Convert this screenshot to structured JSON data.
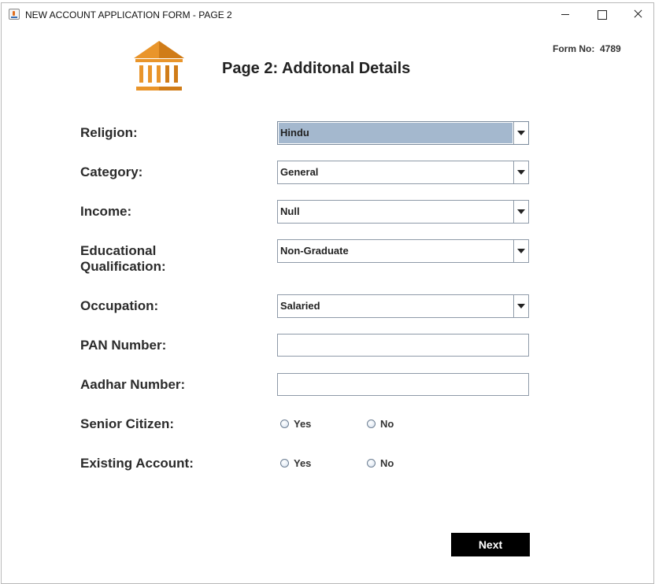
{
  "window": {
    "title": "NEW ACCOUNT APPLICATION FORM - PAGE 2"
  },
  "header": {
    "form_no_label": "Form No:",
    "form_no_value": "4789",
    "heading": "Page 2: Additonal Details",
    "logo_icon": "bank-building-icon"
  },
  "colors": {
    "logo": "#e9952b",
    "selection_highlight": "#a4b8ce",
    "next_button_bg": "#000000",
    "next_button_text": "#ffffff"
  },
  "fields": {
    "religion": {
      "label": "Religion:",
      "value": "Hindu"
    },
    "category": {
      "label": "Category:",
      "value": "General"
    },
    "income": {
      "label": "Income:",
      "value": "Null"
    },
    "education": {
      "label_line1": "Educational",
      "label_line2": "Qualification:",
      "value": "Non-Graduate"
    },
    "occupation": {
      "label": "Occupation:",
      "value": "Salaried"
    },
    "pan": {
      "label": "PAN Number:",
      "value": ""
    },
    "aadhar": {
      "label": "Aadhar Number:",
      "value": ""
    },
    "senior_citizen": {
      "label": "Senior Citizen:",
      "option_yes": "Yes",
      "option_no": "No",
      "selected": null
    },
    "existing_account": {
      "label": "Existing Account:",
      "option_yes": "Yes",
      "option_no": "No",
      "selected": null
    }
  },
  "actions": {
    "next_label": "Next"
  }
}
